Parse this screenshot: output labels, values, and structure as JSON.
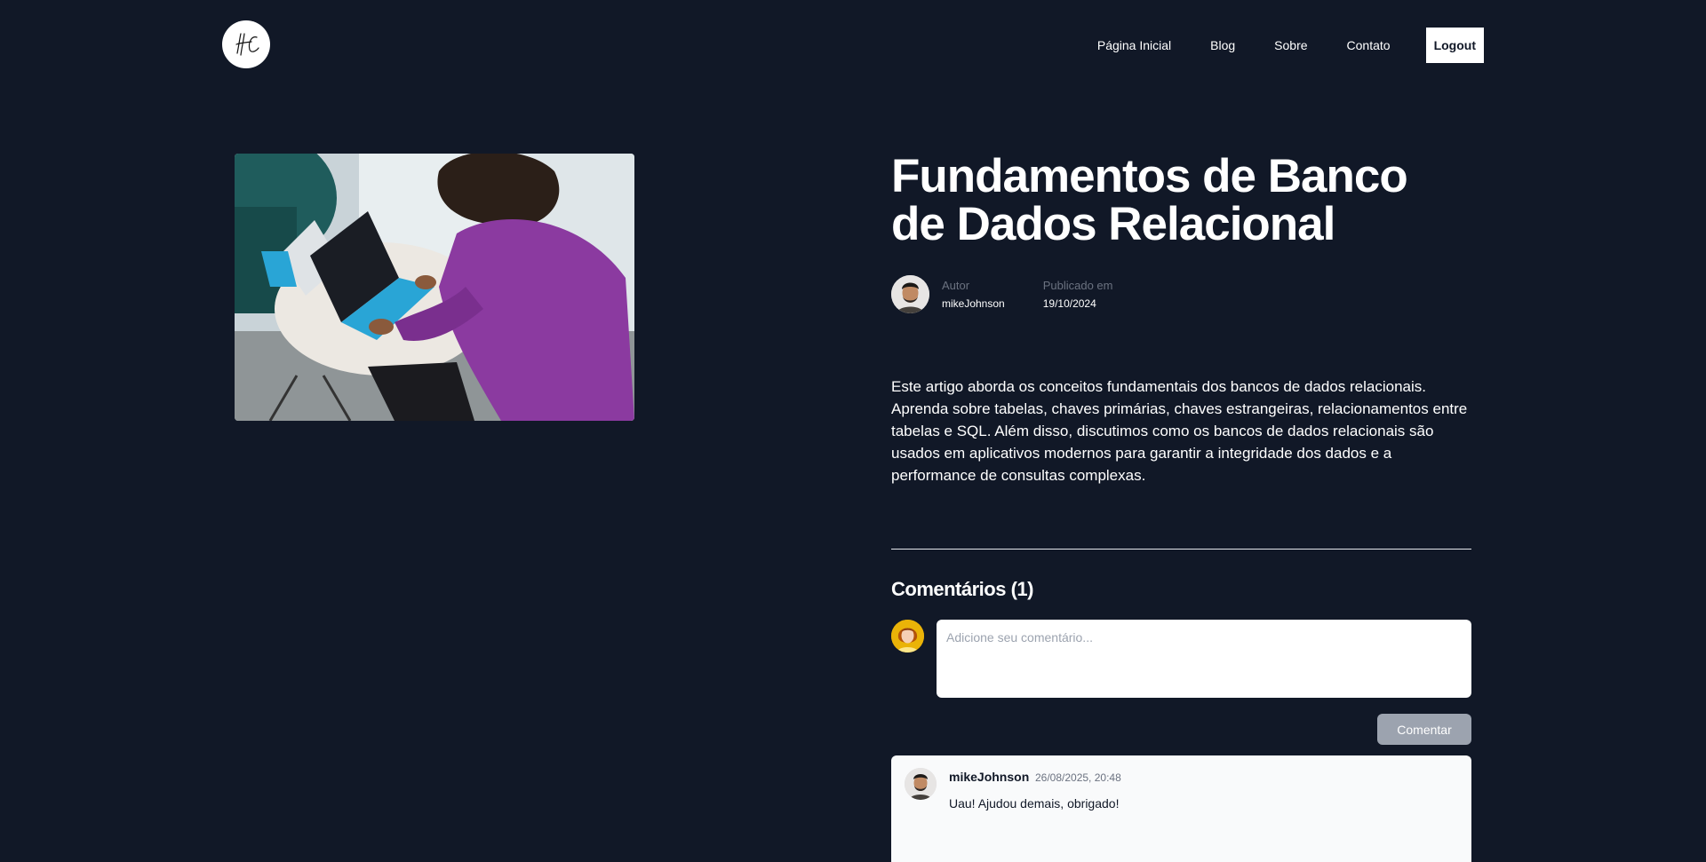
{
  "header": {
    "logo_icon": "hc-signature-logo-icon",
    "nav": [
      {
        "label": "Página Inicial"
      },
      {
        "label": "Blog"
      },
      {
        "label": "Sobre"
      },
      {
        "label": "Contato"
      }
    ],
    "logout_label": "Logout"
  },
  "hero": {
    "image_icon": "person-typing-laptop-photo"
  },
  "article": {
    "title": "Fundamentos de Banco de Dados Relacional",
    "author_label": "Autor",
    "author_name": "mikeJohnson",
    "published_label": "Publicado em",
    "published_date": "19/10/2024",
    "description": "Este artigo aborda os conceitos fundamentais dos bancos de dados relacionais. Aprenda sobre tabelas, chaves primárias, chaves estrangeiras, relacionamentos entre tabelas e SQL. Além disso, discutimos como os bancos de dados relacionais são usados em aplicativos modernos para garantir a integridade dos dados e a performance de consultas complexas."
  },
  "comments": {
    "title": "Comentários (1)",
    "input_placeholder": "Adicione seu comentário...",
    "input_value": "",
    "submit_label": "Comentar",
    "items": [
      {
        "author": "mikeJohnson",
        "date": "26/08/2025, 20:48",
        "text": "Uau! Ajudou demais, obrigado!"
      }
    ]
  },
  "colors": {
    "background": "#111827",
    "text": "#ffffff",
    "muted": "#6b7280",
    "button_disabled": "#9ca3af",
    "card": "#f9fafb"
  }
}
